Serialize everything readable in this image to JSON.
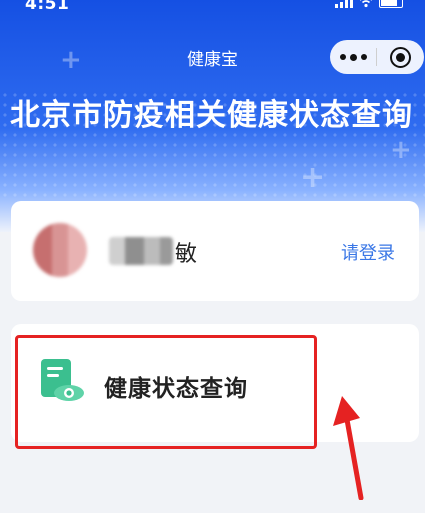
{
  "status_bar": {
    "time": "4:51"
  },
  "header": {
    "app_title": "健康宝",
    "page_title": "北京市防疫相关健康状态查询"
  },
  "user_card": {
    "name_visible_char": "敏",
    "login_label": "请登录"
  },
  "query_card": {
    "label": "健康状态查询"
  },
  "colors": {
    "header_blue": "#1550e3",
    "accent_link": "#3a77e6",
    "icon_green": "#3bbf8f",
    "annotation_red": "#e52222"
  },
  "icons": {
    "capsule_more": "more-dots-icon",
    "capsule_close": "close-target-icon",
    "query": "health-document-shield-icon"
  }
}
